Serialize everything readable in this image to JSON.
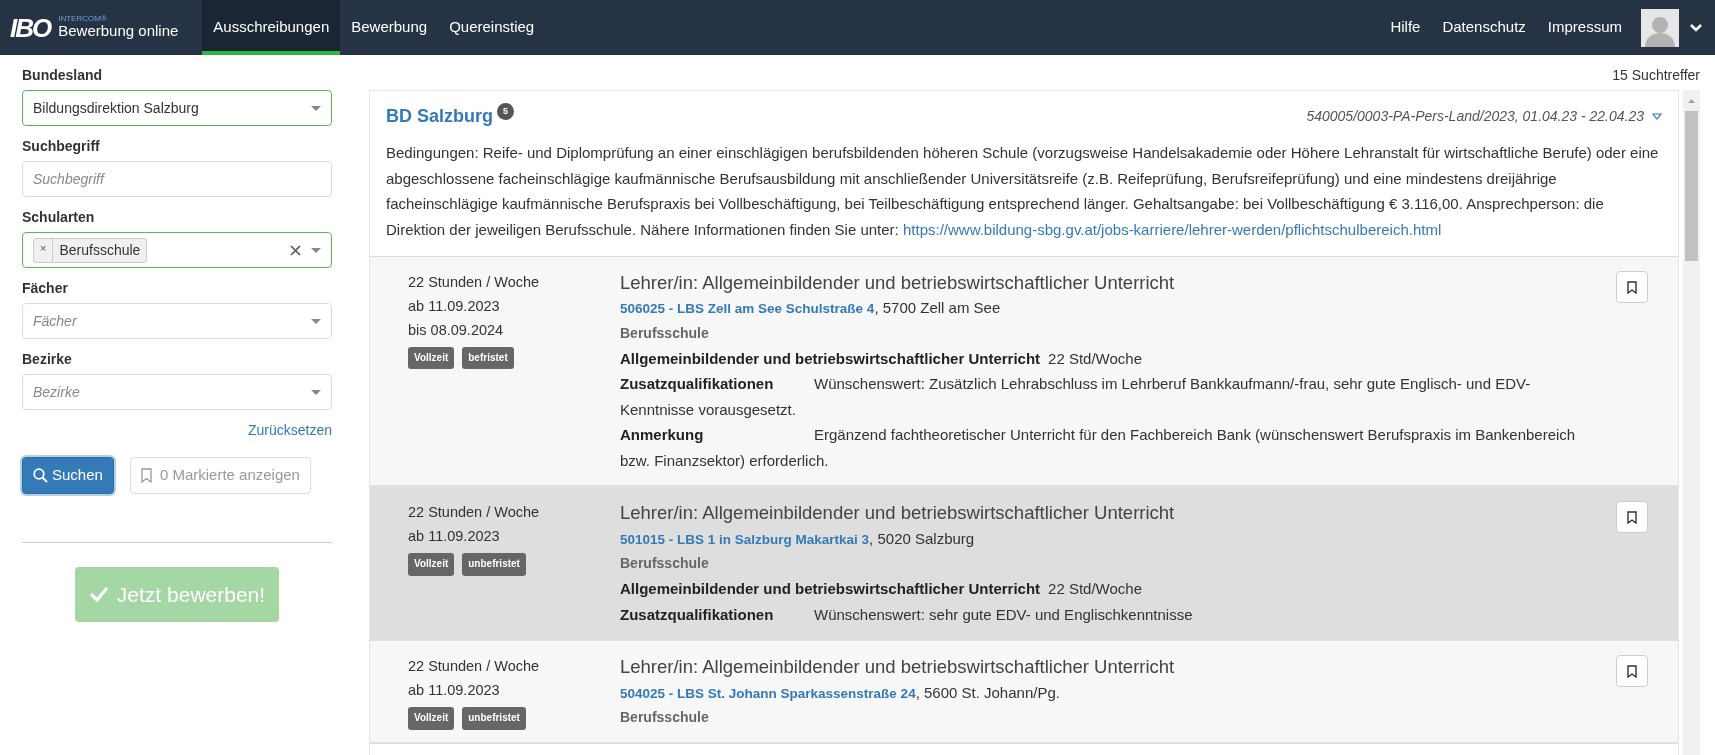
{
  "navbar": {
    "logo_text": "IBO",
    "brand_small": "INTERCOM®",
    "brand": "Bewerbung online",
    "tabs": [
      {
        "label": "Ausschreibungen",
        "selected": true
      },
      {
        "label": "Bewerbung",
        "selected": false
      },
      {
        "label": "Quereinstieg",
        "selected": false
      }
    ],
    "links": [
      "Hilfe",
      "Datenschutz",
      "Impressum"
    ]
  },
  "sidebar": {
    "fields": [
      {
        "kind": "select",
        "label": "Bundesland",
        "value": "Bildungsdirektion Salzburg",
        "valid": true
      },
      {
        "kind": "text",
        "label": "Suchbegriff",
        "placeholder": "Suchbegriff",
        "valid": false
      },
      {
        "kind": "tags",
        "label": "Schularten",
        "tags": [
          {
            "remove": "×",
            "label": "Berufsschule"
          }
        ],
        "valid": true
      },
      {
        "kind": "select",
        "label": "Fächer",
        "placeholder": "Fächer",
        "valid": false
      },
      {
        "kind": "select",
        "label": "Bezirke",
        "placeholder": "Bezirke",
        "valid": false
      }
    ],
    "reset_link": "Zurücksetzen",
    "search_button": "Suchen",
    "marked_button": "0 Markierte anzeigen",
    "apply_button": {
      "label": "Jetzt bewerben!",
      "disabled": true
    }
  },
  "results": {
    "count": "15 Suchtreffer",
    "group": {
      "title": "BD Salzburg",
      "badge": "5",
      "reference": "540005/0003-PA-Pers-Land/2023, 01.04.23 - 22.04.23",
      "expanded": true,
      "description": "Bedingungen: Reife- und Diplomprüfung an einer einschlägigen berufsbildenden höheren Schule (vorzugsweise Handelsakademie oder Höhere Lehranstalt für wirtschaftliche Berufe) oder eine abgeschlossene facheinschlägige kaufmännische Berufsausbildung mit anschließender Universitätsreife (z.B. Reifeprüfung, Berufsreifeprüfung) und eine mindestens dreijährige facheinschlägige kaufmännische Berufspraxis bei Vollbeschäftigung, bei Teilbeschäftigung entsprechend länger. Gehaltsangabe: bei Vollbeschäftigung € 3.116,00. Ansprechperson: die Direktion der jeweiligen Berufsschule. Nähere Informationen finden Sie unter:",
      "link": "https://www.bildung-sbg.gv.at/jobs-karriere/lehrer-werden/pflichtschulbereich.html"
    },
    "listings": [
      {
        "highlighted": false,
        "meta": [
          "22 Stunden / Woche",
          "ab 11.09.2023",
          "bis 08.09.2024"
        ],
        "tags": [
          "Vollzeit",
          "befristet"
        ],
        "title": "Lehrer/in: Allgemeinbildender und betriebswirtschaftlicher Unterricht",
        "school": "506025 - LBS Zell am See Schulstraße 4",
        "address": ", 5700 Zell am See",
        "school_type": "Berufsschule",
        "details": [
          {
            "label": "Allgemeinbildender und betriebswirtschaftlicher Unterricht",
            "value": "22 Std/Woche"
          },
          {
            "label": "Zusatzqualifikationen",
            "value": "Wünschenswert: Zusätzlich Lehrabschluss im Lehrberuf Bankkaufmann/-frau, sehr gute Englisch- und EDV-Kenntnisse vorausgesetzt."
          },
          {
            "label": "Anmerkung",
            "value": "Ergänzend fachtheoretischer Unterricht für den Fachbereich Bank (wünschenswert Berufspraxis im Bankenbereich bzw. Finanzsektor) erforderlich."
          }
        ]
      },
      {
        "highlighted": true,
        "meta": [
          "22 Stunden / Woche",
          "ab 11.09.2023"
        ],
        "tags": [
          "Vollzeit",
          "unbefristet"
        ],
        "title": "Lehrer/in: Allgemeinbildender und betriebswirtschaftlicher Unterricht",
        "school": "501015 - LBS 1 in Salzburg Makartkai 3",
        "address": ", 5020 Salzburg",
        "school_type": "Berufsschule",
        "details": [
          {
            "label": "Allgemeinbildender und betriebswirtschaftlicher Unterricht",
            "value": "22 Std/Woche"
          },
          {
            "label": "Zusatzqualifikationen",
            "value": "Wünschenswert: sehr gute EDV- und Englischkenntnisse"
          }
        ]
      },
      {
        "highlighted": false,
        "meta": [
          "22 Stunden / Woche",
          "ab 11.09.2023"
        ],
        "tags": [
          "Vollzeit",
          "unbefristet"
        ],
        "title": "Lehrer/in: Allgemeinbildender und betriebswirtschaftlicher Unterricht",
        "school": "504025 - LBS St. Johann Sparkassenstraße 24",
        "address": ", 5600 St. Johann/Pg.",
        "school_type": "Berufsschule"
      }
    ]
  }
}
